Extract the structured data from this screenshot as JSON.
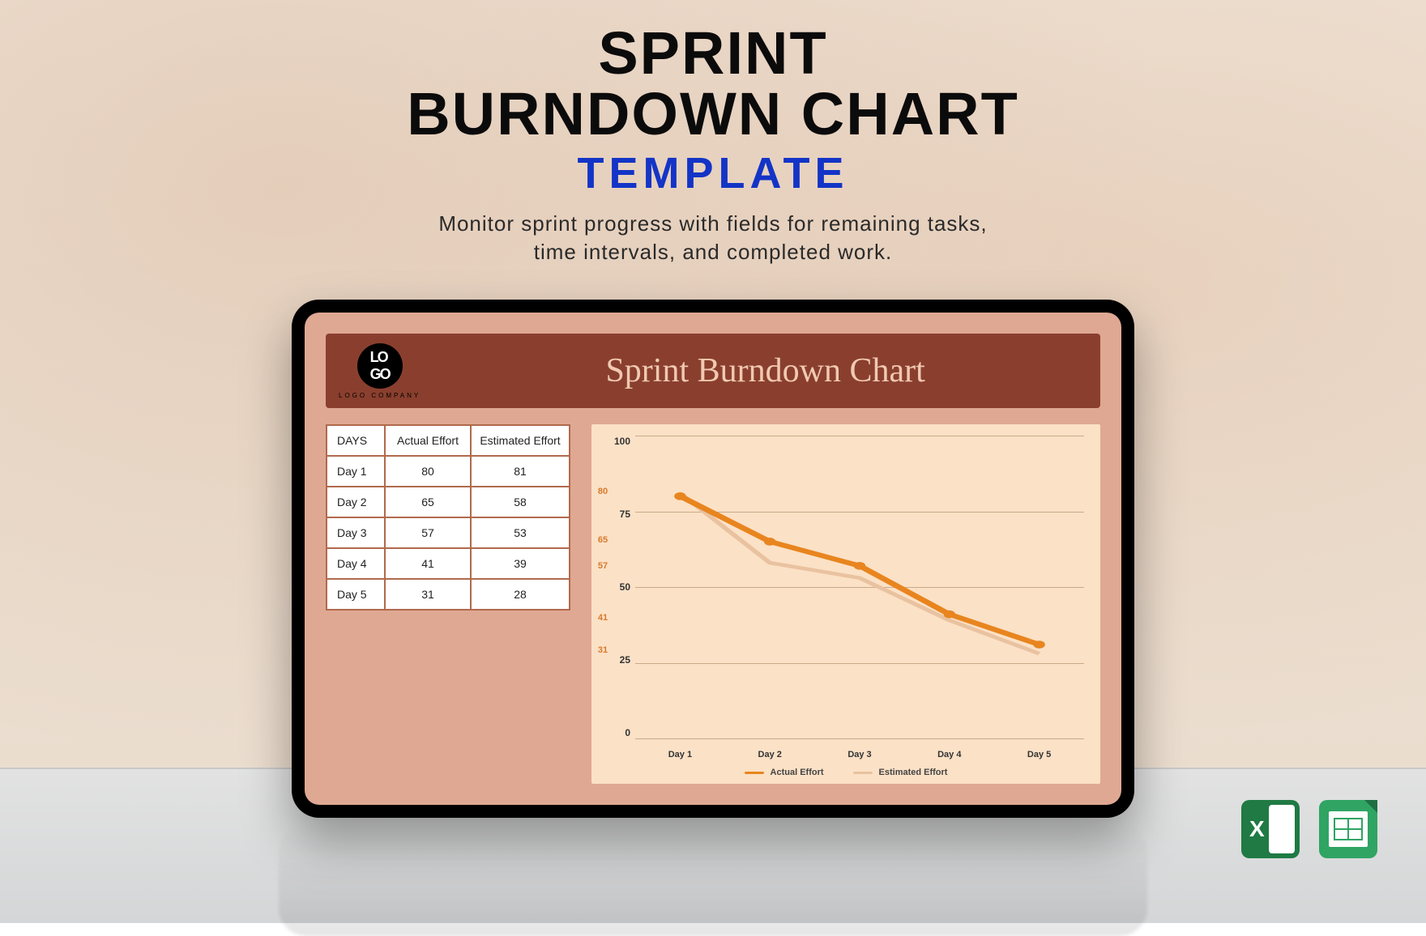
{
  "heading": {
    "line1": "SPRINT",
    "line2": "BURNDOWN CHART",
    "line3": "TEMPLATE",
    "sub1": "Monitor sprint progress with fields for remaining tasks,",
    "sub2": "time intervals, and completed work."
  },
  "banner": {
    "logo_text": "LO\nGO",
    "logo_caption": "LOGO COMPANY",
    "title": "Sprint Burndown Chart"
  },
  "table": {
    "headers": [
      "DAYS",
      "Actual Effort",
      "Estimated Effort"
    ],
    "rows": [
      {
        "day": "Day 1",
        "actual": 80,
        "estimated": 81
      },
      {
        "day": "Day 2",
        "actual": 65,
        "estimated": 58
      },
      {
        "day": "Day 3",
        "actual": 57,
        "estimated": 53
      },
      {
        "day": "Day 4",
        "actual": 41,
        "estimated": 39
      },
      {
        "day": "Day 5",
        "actual": 31,
        "estimated": 28
      }
    ]
  },
  "chart_data": {
    "type": "line",
    "categories": [
      "Day 1",
      "Day 2",
      "Day 3",
      "Day 4",
      "Day 5"
    ],
    "series": [
      {
        "name": "Actual Effort",
        "values": [
          80,
          65,
          57,
          41,
          31
        ],
        "color": "#e8851f"
      },
      {
        "name": "Estimated Effort",
        "values": [
          81,
          58,
          53,
          39,
          28
        ],
        "color": "#e9c2a0"
      }
    ],
    "ylim": [
      0,
      100
    ],
    "yticks": [
      100,
      75,
      50,
      25,
      0
    ],
    "data_labels": [
      80,
      65,
      57,
      41,
      31
    ]
  },
  "legend": {
    "s1": "Actual Effort",
    "s2": "Estimated Effort"
  },
  "icons": {
    "excel": "Microsoft Excel",
    "sheets": "Google Sheets"
  }
}
